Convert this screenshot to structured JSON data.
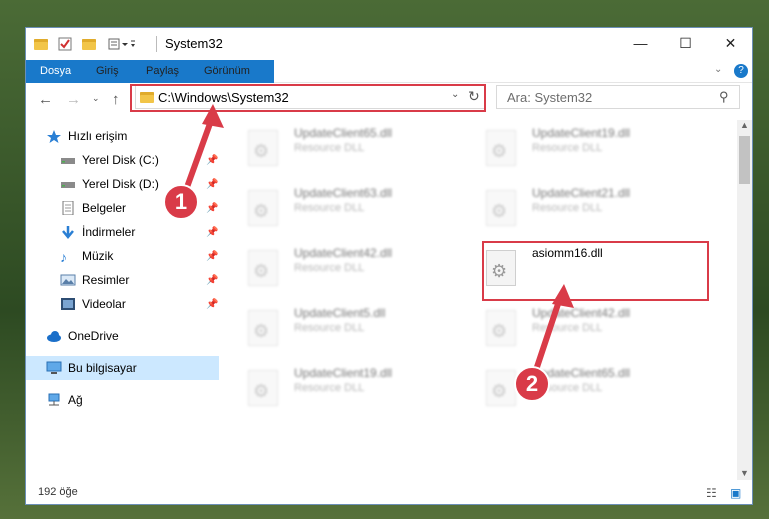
{
  "window": {
    "title": "System32",
    "controls": {
      "minimize": "—",
      "maximize": "☐",
      "close": "✕"
    }
  },
  "ribbon": {
    "tabs": [
      "Dosya",
      "Giriş",
      "Paylaş",
      "Görünüm"
    ]
  },
  "nav": {
    "address": "C:\\Windows\\System32",
    "search_placeholder": "Ara: System32"
  },
  "sidebar": {
    "items": [
      {
        "label": "Hızlı erişim",
        "icon": "star-icon"
      },
      {
        "label": "Yerel Disk (C:)",
        "icon": "drive-icon",
        "pinned": true
      },
      {
        "label": "Yerel Disk (D:)",
        "icon": "drive-icon",
        "pinned": true
      },
      {
        "label": "Belgeler",
        "icon": "document-icon",
        "pinned": true
      },
      {
        "label": "İndirmeler",
        "icon": "download-icon",
        "pinned": true
      },
      {
        "label": "Müzik",
        "icon": "music-icon",
        "pinned": true
      },
      {
        "label": "Resimler",
        "icon": "pictures-icon",
        "pinned": true
      },
      {
        "label": "Videolar",
        "icon": "video-icon",
        "pinned": true
      },
      {
        "label": "OneDrive",
        "icon": "cloud-icon"
      },
      {
        "label": "Bu bilgisayar",
        "icon": "computer-icon",
        "selected": true
      },
      {
        "label": "Ağ",
        "icon": "network-icon"
      }
    ]
  },
  "files": [
    {
      "name": "UpdateClient65.dll",
      "desc": "Resource DLL"
    },
    {
      "name": "UpdateClient19.dll",
      "desc": "Resource DLL"
    },
    {
      "name": "UpdateClient63.dll",
      "desc": "Resource DLL"
    },
    {
      "name": "UpdateClient21.dll",
      "desc": "Resource DLL"
    },
    {
      "name": "UpdateClient42.dll",
      "desc": "Resource DLL"
    },
    {
      "name": "asiomm16.dll",
      "desc": ""
    },
    {
      "name": "UpdateClient5.dll",
      "desc": "Resource DLL"
    },
    {
      "name": "UpdateClient42.dll",
      "desc": "Resource DLL"
    },
    {
      "name": "UpdateClient19.dll",
      "desc": "Resource DLL"
    },
    {
      "name": "UpdateClient65.dll",
      "desc": "Resource DLL"
    }
  ],
  "status": {
    "count": "192 öğe"
  },
  "annotations": {
    "step1": "1",
    "step2": "2",
    "color": "#d93b48"
  }
}
